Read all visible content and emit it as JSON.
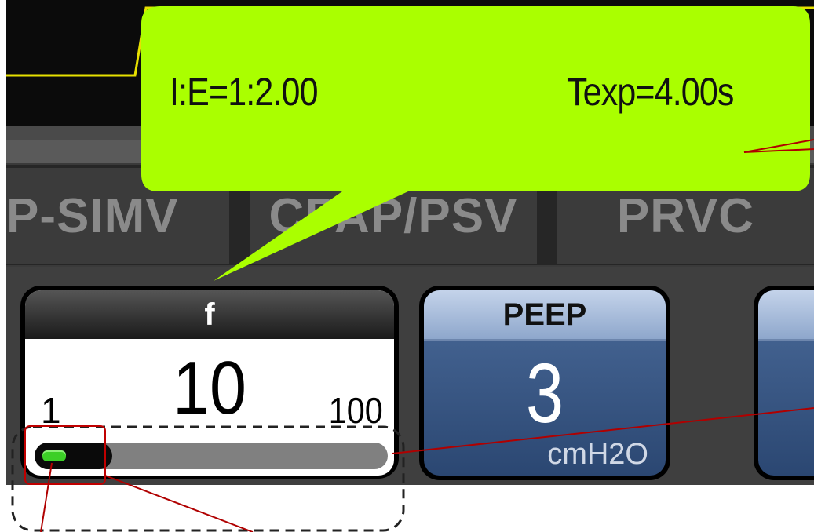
{
  "callout": {
    "ie_ratio": "I:E=1:2.00",
    "texp": "Texp=4.00s"
  },
  "mode_tabs": [
    {
      "label": "P-SIMV"
    },
    {
      "label": "CPAP/PSV"
    },
    {
      "label": "PRVC"
    }
  ],
  "f_param": {
    "label": "f",
    "value": "10",
    "min": "1",
    "max": "100",
    "slider_fraction": 0.09
  },
  "peep_param": {
    "label": "PEEP",
    "value": "3",
    "unit": "cmH2O"
  },
  "colors": {
    "callout": "#aaff00",
    "slider_thumb": "#3ccf27",
    "annotation_line": "#b00000"
  }
}
